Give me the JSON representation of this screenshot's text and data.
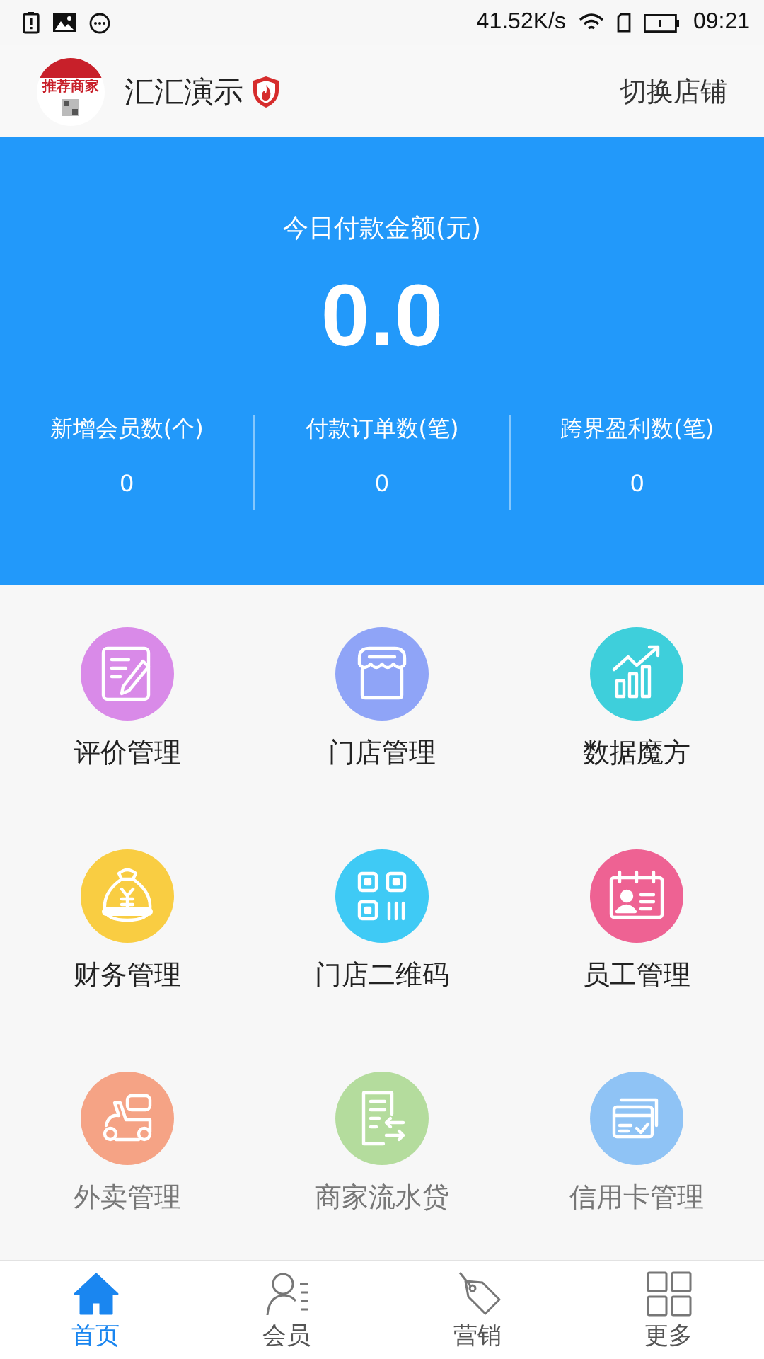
{
  "status_bar": {
    "speed": "41.52K/s",
    "time": "09:21"
  },
  "header": {
    "logo_text": "推荐商家",
    "store_name": "汇汇演示",
    "switch_label": "切换店铺"
  },
  "summary": {
    "label": "今日付款金额(元)",
    "amount": "0.0",
    "stats": [
      {
        "label": "新增会员数(个)",
        "value": "0"
      },
      {
        "label": "付款订单数(笔)",
        "value": "0"
      },
      {
        "label": "跨界盈利数(笔)",
        "value": "0"
      }
    ]
  },
  "features": [
    {
      "label": "评价管理",
      "kind": "review",
      "color": "#d98ae8",
      "disabled": false
    },
    {
      "label": "门店管理",
      "kind": "store",
      "color": "#8fa4f7",
      "disabled": false
    },
    {
      "label": "数据魔方",
      "kind": "chart",
      "color": "#3ecfdb",
      "disabled": false
    },
    {
      "label": "财务管理",
      "kind": "money",
      "color": "#f9cd42",
      "disabled": false
    },
    {
      "label": "门店二维码",
      "kind": "qr",
      "color": "#3fcaf5",
      "disabled": false
    },
    {
      "label": "员工管理",
      "kind": "staff",
      "color": "#ee6293",
      "disabled": false
    },
    {
      "label": "外卖管理",
      "kind": "delivery",
      "color": "#f5a385",
      "disabled": true
    },
    {
      "label": "商家流水贷",
      "kind": "loan",
      "color": "#b4dc9d",
      "disabled": true
    },
    {
      "label": "信用卡管理",
      "kind": "card",
      "color": "#8fc3f5",
      "disabled": true
    }
  ],
  "tabs": [
    {
      "label": "首页",
      "kind": "home",
      "selected": true
    },
    {
      "label": "会员",
      "kind": "member",
      "selected": false
    },
    {
      "label": "营销",
      "kind": "tag",
      "selected": false
    },
    {
      "label": "更多",
      "kind": "more",
      "selected": false
    }
  ]
}
